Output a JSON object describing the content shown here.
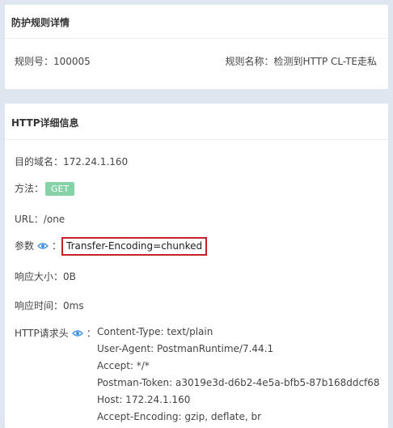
{
  "rule_card": {
    "title": "防护规则详情",
    "rule_id": "规则号：100005",
    "rule_name": "规则名称：检测到HTTP CL-TE走私"
  },
  "http_card": {
    "title": "HTTP详细信息",
    "domain": "目的域名：172.24.1.160",
    "method_label": "方法：",
    "method_value": "GET",
    "url": "URL：/one",
    "params_label": "参数",
    "params_colon": "：",
    "params_value": "Transfer-Encoding=chunked",
    "size": "响应大小：0B",
    "time": "响应时间：0ms",
    "headers_label": "HTTP请求头",
    "headers_colon": "：",
    "headers": [
      "Content-Type: text/plain",
      "User-Agent: PostmanRuntime/7.44.1",
      "Accept: */*",
      "Postman-Token: a3019e3d-d6b2-4e5a-bfb5-87b168ddcf68",
      "Host: 172.24.1.160",
      "Accept-Encoding: gzip, deflate, br"
    ]
  },
  "colors": {
    "badge": "#84d2a6",
    "highlight_border": "#c8202a",
    "icon": "#3d8fe0"
  },
  "icons": [
    "eye-icon"
  ]
}
